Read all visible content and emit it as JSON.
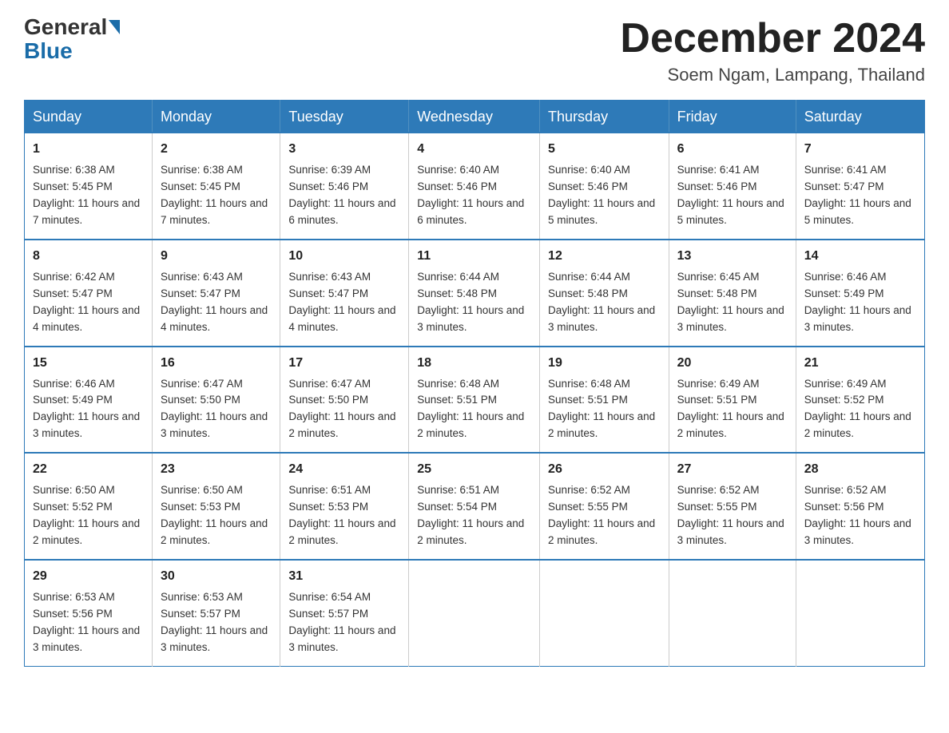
{
  "header": {
    "logo_general": "General",
    "logo_blue": "Blue",
    "month_title": "December 2024",
    "location": "Soem Ngam, Lampang, Thailand"
  },
  "days_of_week": [
    "Sunday",
    "Monday",
    "Tuesday",
    "Wednesday",
    "Thursday",
    "Friday",
    "Saturday"
  ],
  "weeks": [
    [
      {
        "day": "1",
        "sunrise": "6:38 AM",
        "sunset": "5:45 PM",
        "daylight": "11 hours and 7 minutes."
      },
      {
        "day": "2",
        "sunrise": "6:38 AM",
        "sunset": "5:45 PM",
        "daylight": "11 hours and 7 minutes."
      },
      {
        "day": "3",
        "sunrise": "6:39 AM",
        "sunset": "5:46 PM",
        "daylight": "11 hours and 6 minutes."
      },
      {
        "day": "4",
        "sunrise": "6:40 AM",
        "sunset": "5:46 PM",
        "daylight": "11 hours and 6 minutes."
      },
      {
        "day": "5",
        "sunrise": "6:40 AM",
        "sunset": "5:46 PM",
        "daylight": "11 hours and 5 minutes."
      },
      {
        "day": "6",
        "sunrise": "6:41 AM",
        "sunset": "5:46 PM",
        "daylight": "11 hours and 5 minutes."
      },
      {
        "day": "7",
        "sunrise": "6:41 AM",
        "sunset": "5:47 PM",
        "daylight": "11 hours and 5 minutes."
      }
    ],
    [
      {
        "day": "8",
        "sunrise": "6:42 AM",
        "sunset": "5:47 PM",
        "daylight": "11 hours and 4 minutes."
      },
      {
        "day": "9",
        "sunrise": "6:43 AM",
        "sunset": "5:47 PM",
        "daylight": "11 hours and 4 minutes."
      },
      {
        "day": "10",
        "sunrise": "6:43 AM",
        "sunset": "5:47 PM",
        "daylight": "11 hours and 4 minutes."
      },
      {
        "day": "11",
        "sunrise": "6:44 AM",
        "sunset": "5:48 PM",
        "daylight": "11 hours and 3 minutes."
      },
      {
        "day": "12",
        "sunrise": "6:44 AM",
        "sunset": "5:48 PM",
        "daylight": "11 hours and 3 minutes."
      },
      {
        "day": "13",
        "sunrise": "6:45 AM",
        "sunset": "5:48 PM",
        "daylight": "11 hours and 3 minutes."
      },
      {
        "day": "14",
        "sunrise": "6:46 AM",
        "sunset": "5:49 PM",
        "daylight": "11 hours and 3 minutes."
      }
    ],
    [
      {
        "day": "15",
        "sunrise": "6:46 AM",
        "sunset": "5:49 PM",
        "daylight": "11 hours and 3 minutes."
      },
      {
        "day": "16",
        "sunrise": "6:47 AM",
        "sunset": "5:50 PM",
        "daylight": "11 hours and 3 minutes."
      },
      {
        "day": "17",
        "sunrise": "6:47 AM",
        "sunset": "5:50 PM",
        "daylight": "11 hours and 2 minutes."
      },
      {
        "day": "18",
        "sunrise": "6:48 AM",
        "sunset": "5:51 PM",
        "daylight": "11 hours and 2 minutes."
      },
      {
        "day": "19",
        "sunrise": "6:48 AM",
        "sunset": "5:51 PM",
        "daylight": "11 hours and 2 minutes."
      },
      {
        "day": "20",
        "sunrise": "6:49 AM",
        "sunset": "5:51 PM",
        "daylight": "11 hours and 2 minutes."
      },
      {
        "day": "21",
        "sunrise": "6:49 AM",
        "sunset": "5:52 PM",
        "daylight": "11 hours and 2 minutes."
      }
    ],
    [
      {
        "day": "22",
        "sunrise": "6:50 AM",
        "sunset": "5:52 PM",
        "daylight": "11 hours and 2 minutes."
      },
      {
        "day": "23",
        "sunrise": "6:50 AM",
        "sunset": "5:53 PM",
        "daylight": "11 hours and 2 minutes."
      },
      {
        "day": "24",
        "sunrise": "6:51 AM",
        "sunset": "5:53 PM",
        "daylight": "11 hours and 2 minutes."
      },
      {
        "day": "25",
        "sunrise": "6:51 AM",
        "sunset": "5:54 PM",
        "daylight": "11 hours and 2 minutes."
      },
      {
        "day": "26",
        "sunrise": "6:52 AM",
        "sunset": "5:55 PM",
        "daylight": "11 hours and 2 minutes."
      },
      {
        "day": "27",
        "sunrise": "6:52 AM",
        "sunset": "5:55 PM",
        "daylight": "11 hours and 3 minutes."
      },
      {
        "day": "28",
        "sunrise": "6:52 AM",
        "sunset": "5:56 PM",
        "daylight": "11 hours and 3 minutes."
      }
    ],
    [
      {
        "day": "29",
        "sunrise": "6:53 AM",
        "sunset": "5:56 PM",
        "daylight": "11 hours and 3 minutes."
      },
      {
        "day": "30",
        "sunrise": "6:53 AM",
        "sunset": "5:57 PM",
        "daylight": "11 hours and 3 minutes."
      },
      {
        "day": "31",
        "sunrise": "6:54 AM",
        "sunset": "5:57 PM",
        "daylight": "11 hours and 3 minutes."
      },
      null,
      null,
      null,
      null
    ]
  ],
  "labels": {
    "sunrise": "Sunrise: ",
    "sunset": "Sunset: ",
    "daylight": "Daylight: "
  }
}
